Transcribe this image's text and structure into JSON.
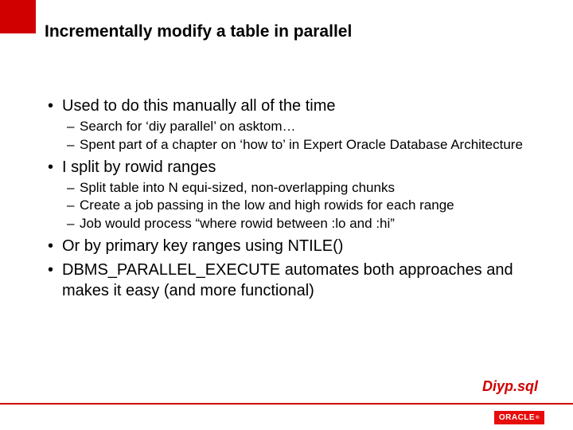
{
  "title": "Incrementally modify a table in parallel",
  "bullets": {
    "b0": {
      "text": "Used to do this manually all of the time",
      "sub": {
        "s0": "Search for ‘diy parallel’ on asktom…",
        "s1": "Spent part of a chapter on ‘how to’ in Expert Oracle Database Architecture"
      }
    },
    "b1": {
      "text": "I split by rowid ranges",
      "sub": {
        "s0": "Split table into N equi-sized, non-overlapping chunks",
        "s1": "Create a job passing in the low and high rowids for each range",
        "s2": "Job would process “where rowid between :lo and :hi”"
      }
    },
    "b2": {
      "text": "Or by primary key ranges using NTILE()"
    },
    "b3": {
      "text": "DBMS_PARALLEL_EXECUTE automates both approaches and makes it easy (and more functional)"
    }
  },
  "footer_label": "Diyp.sql",
  "logo_text": "ORACLE",
  "logo_reg": "®"
}
